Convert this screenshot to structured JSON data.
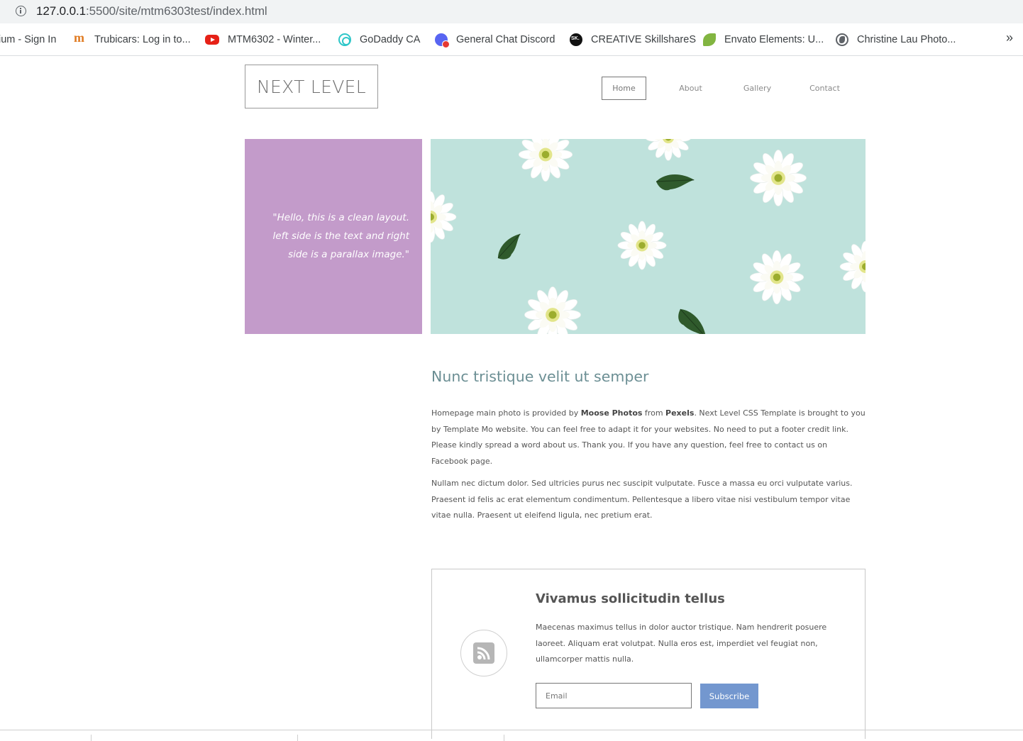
{
  "browser": {
    "url_host": "127.0.0.1",
    "url_path": ":5500/site/mtm6303test/index.html",
    "bookmarks": [
      {
        "label": "ium - Sign In",
        "icon": "none"
      },
      {
        "label": "Trubicars: Log in to...",
        "icon": "moodle-icon"
      },
      {
        "label": "MTM6302 - Winter...",
        "icon": "youtube-icon"
      },
      {
        "label": "GoDaddy CA",
        "icon": "godaddy-icon"
      },
      {
        "label": "General Chat Discord",
        "icon": "discord-icon"
      },
      {
        "label": "CREATIVE SkillshareS",
        "icon": "skillshare-icon"
      },
      {
        "label": "Envato Elements: U...",
        "icon": "envato-icon"
      },
      {
        "label": "Christine Lau Photo...",
        "icon": "globe-icon"
      }
    ],
    "more_label": "»"
  },
  "site": {
    "logo": "NEXT LEVEL",
    "nav": [
      "Home",
      "About",
      "Gallery",
      "Contact"
    ],
    "active_nav": "Home",
    "quote": "\"Hello, this is a clean layout. left side is the text and right side is a parallax image.\"",
    "heading": "Nunc tristique velit ut semper",
    "para1": {
      "t1": "Homepage main photo is provided by ",
      "b1": "Moose Photos",
      "t2": " from ",
      "b2": "Pexels",
      "t3": ". Next Level CSS Template is brought to you by Template Mo website. You can feel free to adapt it for your websites. No need to put a footer credit link. Please kindly spread a word about us. Thank you. If you have any question, feel free to contact us on Facebook page."
    },
    "para2": "Nullam nec dictum dolor. Sed ultricies purus nec suscipit vulputate. Fusce a massa eu orci vulputate varius. Praesent id felis ac erat elementum condimentum. Pellentesque a libero vitae nisi vestibulum tempor vitae vitae nulla. Praesent ut eleifend ligula, nec pretium erat.",
    "card": {
      "title": "Vivamus sollicitudin tellus",
      "text": "Maecenas maximus tellus in dolor auctor tristique. Nam hendrerit posuere laoreet. Aliquam erat volutpat. Nulla eros est, imperdiet vel feugiat non, ullamcorper mattis nulla.",
      "email_placeholder": "Email",
      "email_value": "",
      "button": "Subscribe"
    }
  },
  "colors": {
    "quote_bg": "#c39bca",
    "hero_bg": "#bfe2dc",
    "heading": "#6c8f94",
    "button": "#7397cf"
  }
}
